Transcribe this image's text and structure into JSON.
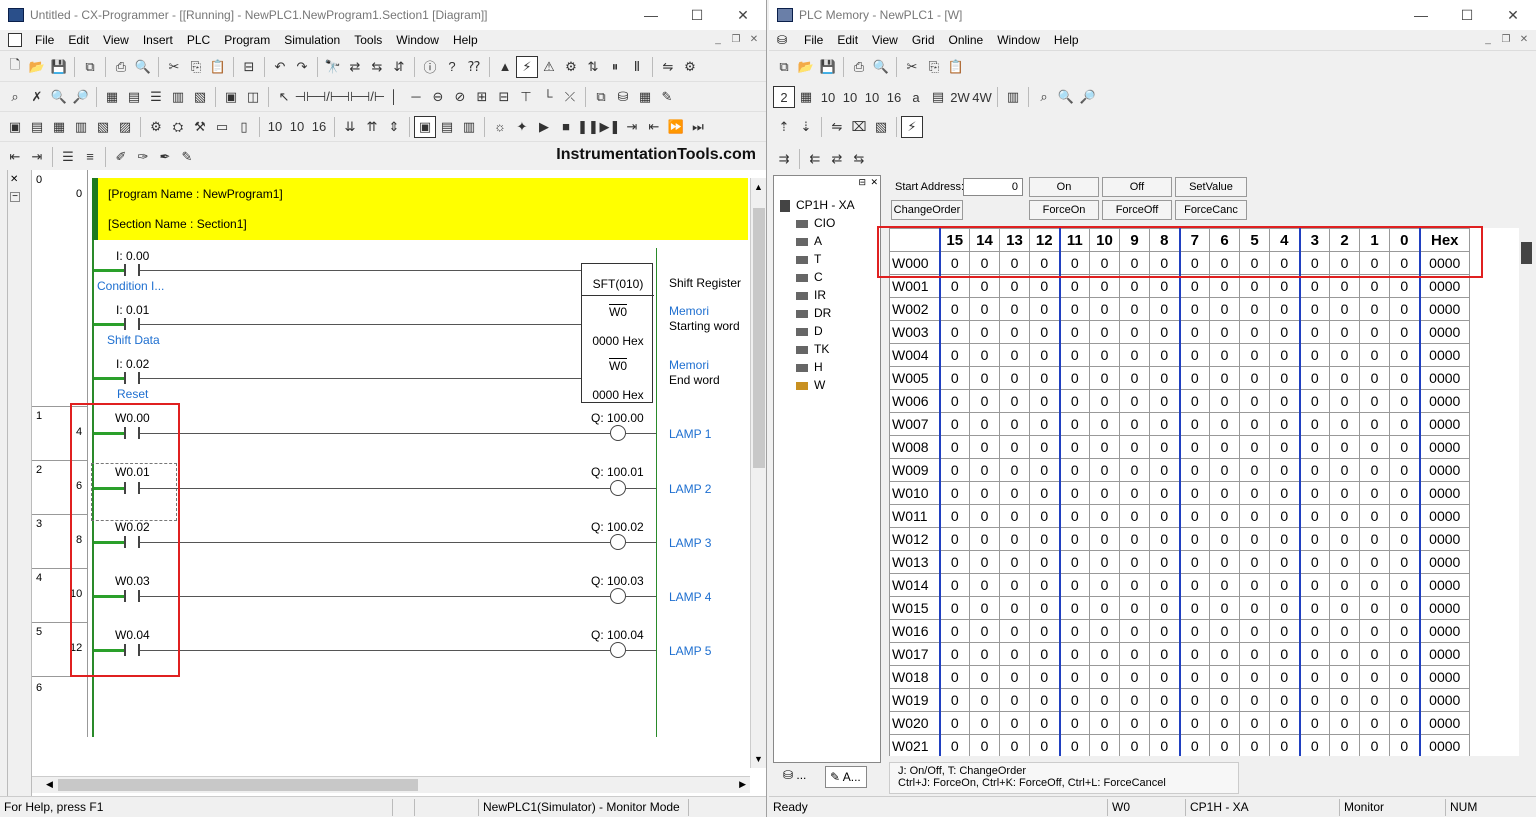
{
  "left": {
    "title": "Untitled - CX-Programmer - [[Running] - NewPLC1.NewProgram1.Section1 [Diagram]]",
    "menu": [
      "File",
      "Edit",
      "View",
      "Insert",
      "PLC",
      "Program",
      "Simulation",
      "Tools",
      "Window",
      "Help"
    ],
    "brand": "InstrumentationTools.com",
    "program_name": "[Program Name : NewProgram1]",
    "section_name": "[Section Name : Section1]",
    "rung_labels": [
      {
        "rung": "0",
        "step": "0"
      },
      {
        "rung": "1",
        "step": "4"
      },
      {
        "rung": "2",
        "step": "6"
      },
      {
        "rung": "3",
        "step": "8"
      },
      {
        "rung": "4",
        "step": "10"
      },
      {
        "rung": "5",
        "step": "12"
      },
      {
        "rung": "6",
        "step": ""
      }
    ],
    "sft": {
      "contacts": [
        {
          "addr": "I: 0.00",
          "comment": "Condition I..."
        },
        {
          "addr": "I: 0.01",
          "comment": "Shift Data"
        },
        {
          "addr": "I: 0.02",
          "comment": "Reset"
        }
      ],
      "instr": "SFT(010)",
      "op1": "W0",
      "op1_val": "0000 Hex",
      "op2": "W0",
      "op2_val": "0000 Hex",
      "title": "Shift Register",
      "op1_comment": "Memori",
      "op1_desc": "Starting word",
      "op2_comment": "Memori",
      "op2_desc": "End word"
    },
    "rungs": [
      {
        "contact": "W0.00",
        "coil": "Q: 100.00",
        "label": "LAMP 1"
      },
      {
        "contact": "W0.01",
        "coil": "Q: 100.01",
        "label": "LAMP 2"
      },
      {
        "contact": "W0.02",
        "coil": "Q: 100.02",
        "label": "LAMP 3"
      },
      {
        "contact": "W0.03",
        "coil": "Q: 100.03",
        "label": "LAMP 4"
      },
      {
        "contact": "W0.04",
        "coil": "Q: 100.04",
        "label": "LAMP 5"
      }
    ],
    "status": {
      "help": "For Help, press F1",
      "mode": "NewPLC1(Simulator) - Monitor Mode"
    }
  },
  "right": {
    "title": "PLC Memory - NewPLC1 - [W]",
    "menu": [
      "File",
      "Edit",
      "View",
      "Grid",
      "Online",
      "Window",
      "Help"
    ],
    "tree": {
      "root": "CP1H - XA",
      "areas": [
        "CIO",
        "A",
        "T",
        "C",
        "IR",
        "DR",
        "D",
        "TK",
        "H",
        "W"
      ]
    },
    "tabs": [
      "...",
      "A..."
    ],
    "form": {
      "start_label": "Start Address:",
      "start_value": "0",
      "buttons": [
        "On",
        "Off",
        "SetValue",
        "ChangeOrder",
        "ForceOn",
        "ForceOff",
        "ForceCanc"
      ]
    },
    "grid": {
      "headers": [
        "15",
        "14",
        "13",
        "12",
        "11",
        "10",
        "9",
        "8",
        "7",
        "6",
        "5",
        "4",
        "3",
        "2",
        "1",
        "0",
        "Hex"
      ],
      "rows": [
        "W000",
        "W001",
        "W002",
        "W003",
        "W004",
        "W005",
        "W006",
        "W007",
        "W008",
        "W009",
        "W010",
        "W011",
        "W012",
        "W013",
        "W014",
        "W015",
        "W016",
        "W017",
        "W018",
        "W019",
        "W020",
        "W021"
      ],
      "bit_value": "0",
      "hex_value": "0000"
    },
    "legend": {
      "line1": "J: On/Off,    T: ChangeOrder",
      "line2": "Ctrl+J: ForceOn,    Ctrl+K: ForceOff,    Ctrl+L: ForceCancel"
    },
    "status": {
      "ready": "Ready",
      "area": "W0",
      "plc": "CP1H - XA",
      "mode": "Monitor",
      "num": "NUM"
    }
  }
}
